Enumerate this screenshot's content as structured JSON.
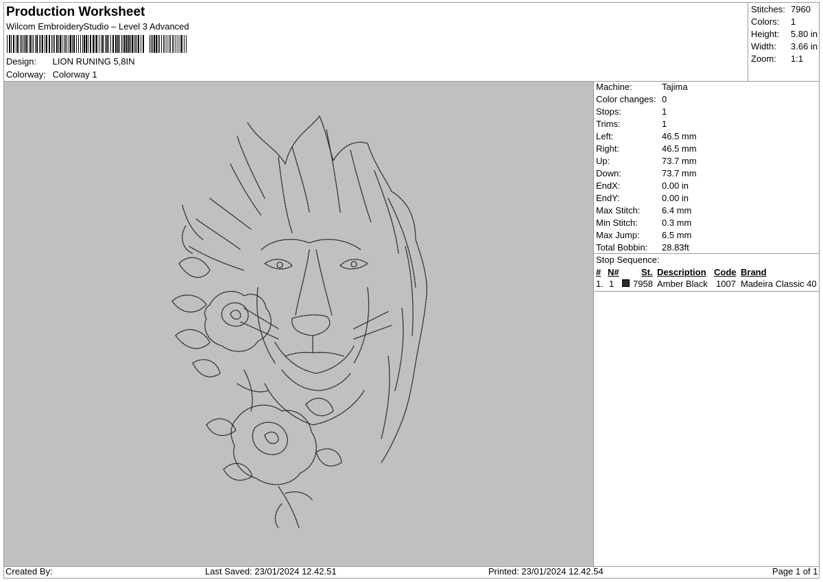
{
  "header": {
    "title": "Production Worksheet",
    "software": "Wilcom EmbroideryStudio – Level 3 Advanced",
    "design_label": "Design:",
    "design_value": "LION RUNING 5,8IN",
    "colorway_label": "Colorway:",
    "colorway_value": "Colorway 1"
  },
  "summary": {
    "stitches_label": "Stitches:",
    "stitches_value": "7960",
    "colors_label": "Colors:",
    "colors_value": "1",
    "height_label": "Height:",
    "height_value": "5.80 in",
    "width_label": "Width:",
    "width_value": "3.66 in",
    "zoom_label": "Zoom:",
    "zoom_value": "1:1"
  },
  "specs": {
    "machine_label": "Machine:",
    "machine_value": "Tajima",
    "color_changes_label": "Color changes:",
    "color_changes_value": "0",
    "stops_label": "Stops:",
    "stops_value": "1",
    "trims_label": "Trims:",
    "trims_value": "1",
    "left_label": "Left:",
    "left_value": "46.5 mm",
    "right_label": "Right:",
    "right_value": "46.5 mm",
    "up_label": "Up:",
    "up_value": "73.7 mm",
    "down_label": "Down:",
    "down_value": "73.7 mm",
    "endx_label": "EndX:",
    "endx_value": "0.00 in",
    "endy_label": "EndY:",
    "endy_value": "0.00 in",
    "max_stitch_label": "Max Stitch:",
    "max_stitch_value": "6.4 mm",
    "min_stitch_label": "Min Stitch:",
    "min_stitch_value": "0.3 mm",
    "max_jump_label": "Max Jump:",
    "max_jump_value": "6.5 mm",
    "total_bobbin_label": "Total Bobbin:",
    "total_bobbin_value": "28.83ft"
  },
  "stop_sequence": {
    "title": "Stop Sequence:",
    "columns": {
      "num": "#",
      "needle": "N#",
      "st": "St.",
      "description": "Description",
      "code": "Code",
      "brand": "Brand"
    },
    "row": {
      "num": "1.",
      "needle": "1",
      "st": "7958",
      "description": "Amber Black",
      "code": "1007",
      "brand": "Madeira Classic 40",
      "swatch_color": "#2b2b2b"
    }
  },
  "footer": {
    "created_by": "Created By:",
    "last_saved": "Last Saved: 23/01/2024 12.42.51",
    "printed": "Printed: 23/01/2024 12.42.54",
    "page": "Page 1 of 1"
  },
  "preview": {
    "background": "#c0c0c0",
    "thread_color": "#2b2b2b",
    "subject": "lion-with-roses-outline"
  }
}
